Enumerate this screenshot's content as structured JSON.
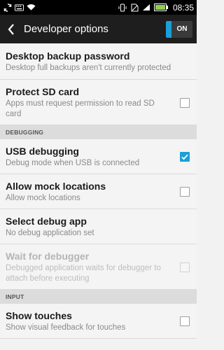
{
  "status_bar": {
    "icons_left": [
      "sync-icon",
      "keyboard-icon",
      "wifi-icon"
    ],
    "icons_right": [
      "vibrate-icon",
      "no-sim-icon",
      "signal-icon",
      "battery-icon"
    ],
    "time": "08:35",
    "colors": {
      "battery": "#8fd14a"
    }
  },
  "action_bar": {
    "title": "Developer options",
    "toggle_label": "ON",
    "colors": {
      "accent": "#1b9fd8"
    }
  },
  "items_top": [
    {
      "title": "Desktop backup password",
      "subtitle": "Desktop full backups aren't currently protected"
    },
    {
      "title": "Protect SD card",
      "subtitle": "Apps must request permission to read SD card",
      "checked": false
    }
  ],
  "sections": {
    "debugging": "DEBUGGING",
    "input": "INPUT"
  },
  "debugging_items": [
    {
      "title": "USB debugging",
      "subtitle": "Debug mode when USB is connected",
      "checked": true
    },
    {
      "title": "Allow mock locations",
      "subtitle": "Allow mock locations",
      "checked": false
    },
    {
      "title": "Select debug app",
      "subtitle": "No debug application set"
    },
    {
      "title": "Wait for debugger",
      "subtitle": "Debugged application waits for debugger to attach before executing",
      "checked": false,
      "disabled": true
    }
  ],
  "input_items": [
    {
      "title": "Show touches",
      "subtitle": "Show visual feedback for touches",
      "checked": false
    }
  ]
}
